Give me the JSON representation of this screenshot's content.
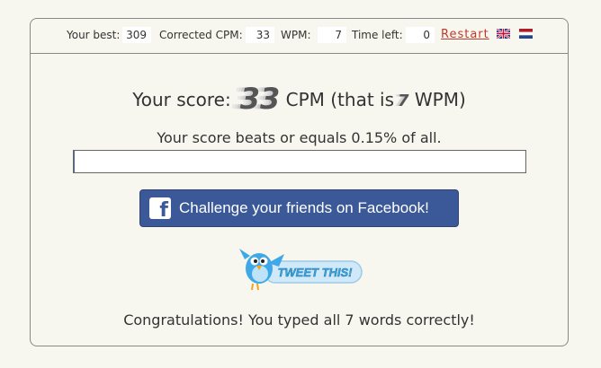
{
  "stats": {
    "best_label": "Your best:",
    "best_value": "309",
    "cpm_label": "Corrected CPM:",
    "cpm_value": "33",
    "wpm_label": "WPM:",
    "wpm_value": "7",
    "time_label": "Time left:",
    "time_value": "0"
  },
  "restart_label": "Restart",
  "flags": [
    "uk-flag-icon",
    "netherlands-flag-icon"
  ],
  "score": {
    "prefix": "Your score:",
    "cpm": "33",
    "cpm_unit": "CPM (that is",
    "wpm": "7",
    "wpm_unit": "WPM)"
  },
  "beats_text": "Your score beats or equals 0.15% of all.",
  "percentile": 0.0015,
  "facebook_label": "Challenge your friends on Facebook!",
  "tweet_label": "TWEET THIS!",
  "congrats_text": "Congratulations! You typed all 7 words correctly!",
  "colors": {
    "restart": "#c0392b",
    "facebook": "#3b5998",
    "bar_fill": "#4a6ea9"
  }
}
